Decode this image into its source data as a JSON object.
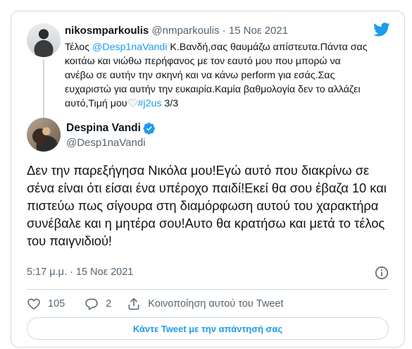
{
  "parent_tweet": {
    "display_name": "nikosmparkoulis",
    "handle": "@nmparkoulis",
    "separator": "·",
    "date": "15 Νοε 2021",
    "text_prefix": "Τέλος ",
    "mention": "@Desp1naVandi",
    "text_body": " Κ.Βανδή,σας θαυμάζω απίστευτα.Πάντα σας κοιτάω και νιώθω περήφανος με τον εαυτό μου που μπορώ να ανέβω σε αυτήν την σκηνή και να κάνω perform για εσάς.Σας ευχαριστώ για αυτήν την ευκαιρία.Καμία βαθμολογία δεν το αλλάζει αυτό,Τιμή μου",
    "hashtag": "#j2us",
    "thread_count": " 3/3"
  },
  "main_tweet": {
    "display_name": "Despina Vandi",
    "handle": "@Desp1naVandi",
    "text": "Δεν την παρεξήγησα Νικόλα μου!Εγώ αυτό που διακρίνω σε σένα είναι ότι είσαι ένα υπέροχο παιδί!Εκεί θα σου έβαζα 10 και πιστεύω πως σίγουρα στη διαμόρφωση αυτού του χαρακτήρα συνέβαλε και η μητέρα σου!Αυτο θα κρατήσω και μετά το τέλος του παιγνιδιού!",
    "timestamp": "5:17 μ.μ. · 15 Νοε 2021"
  },
  "actions": {
    "likes": "105",
    "replies": "2",
    "share_label": "Κοινοποίηση αυτού του Tweet"
  },
  "reply_button_label": "Κάντε Tweet με την απάντησή σας",
  "colors": {
    "accent": "#1d9bf0",
    "text": "#0f1419",
    "muted": "#536471",
    "border": "#cfd9de"
  },
  "icons": [
    "twitter-logo-icon",
    "verified-badge-icon",
    "info-icon",
    "heart-icon",
    "reply-icon",
    "share-icon",
    "white-heart-emoji"
  ]
}
